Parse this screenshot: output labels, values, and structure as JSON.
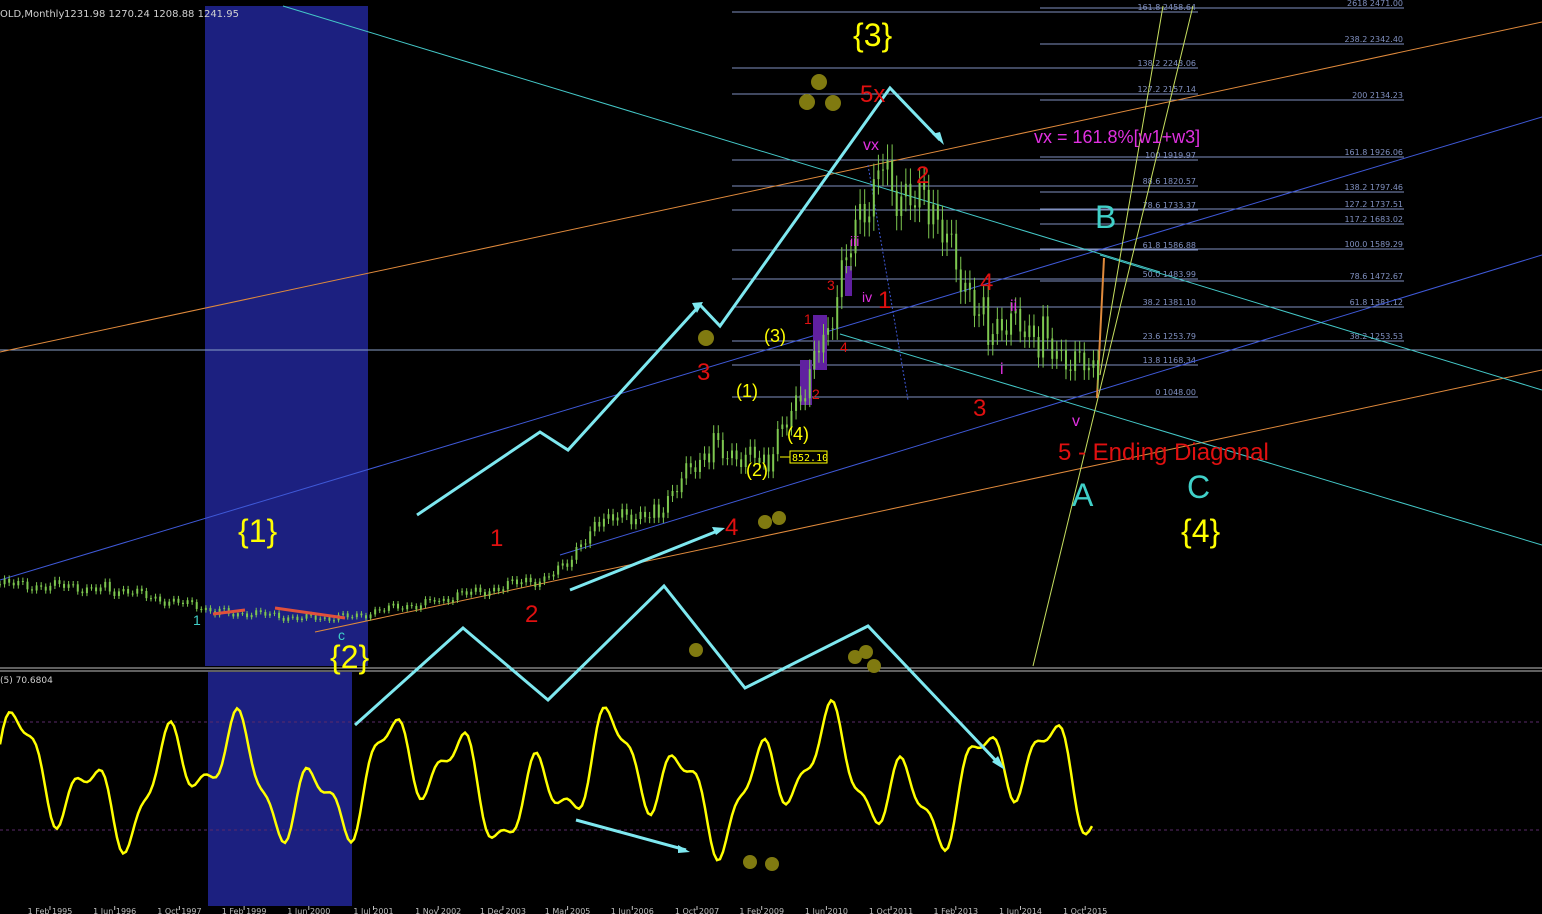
{
  "window": {
    "symbol_info": "OLD,Monthly",
    "ohlc": "1231.98 1270.24 1208.88 1241.95",
    "indicator_label": "(5) 70.6804",
    "price_box": "852.10"
  },
  "x_axis": {
    "ticks": [
      "1 Feb 1995",
      "1 Jun 1996",
      "1 Oct 1997",
      "1 Feb 1999",
      "1 Jun 2000",
      "1 Jul 2001",
      "1 Nov 2002",
      "1 Dec 2003",
      "1 Mar 2005",
      "1 Jun 2006",
      "1 Oct 2007",
      "1 Feb 2009",
      "1 Jun 2010",
      "1 Oct 2011",
      "1 Feb 2013",
      "1 Jun 2014",
      "1 Oct 2015"
    ]
  },
  "fib_levels_left": [
    {
      "label": "161.8 2458.64"
    },
    {
      "label": "138.2 2243.06"
    },
    {
      "label": "127.2 2157.14"
    },
    {
      "label": "100 1919.97"
    },
    {
      "label": "88.6 1820.57"
    },
    {
      "label": "78.6 1733.37"
    },
    {
      "label": "61.8 1586.88"
    },
    {
      "label": "50.0 1483.99"
    },
    {
      "label": "38.2 1381.10"
    },
    {
      "label": "23.6 1253.79"
    },
    {
      "label": "13.8 1168.34"
    },
    {
      "label": "0 1048.00"
    }
  ],
  "fib_levels_right": [
    {
      "label": "2618 2471.00"
    },
    {
      "label": "238.2 2342.40"
    },
    {
      "label": "200 2134.23"
    },
    {
      "label": "161.8 1926.06"
    },
    {
      "label": "138.2 1797.46"
    },
    {
      "label": "127.2 1737.51"
    },
    {
      "label": "117.2 1683.02"
    },
    {
      "label": "100.0 1589.29"
    },
    {
      "label": "78.6 1472.67"
    },
    {
      "label": "61.8 1381.12"
    },
    {
      "label": "38.2 1253.53"
    }
  ],
  "wave_labels": [
    {
      "text": "{1}",
      "color": "#ffff00"
    },
    {
      "text": "{2}",
      "color": "#ffff00"
    },
    {
      "text": "{3}",
      "color": "#ffff00"
    },
    {
      "text": "{4}",
      "color": "#ffff00"
    },
    {
      "text": "1",
      "color": "#e01010"
    },
    {
      "text": "2",
      "color": "#e01010"
    },
    {
      "text": "3",
      "color": "#e01010"
    },
    {
      "text": "4",
      "color": "#e01010"
    },
    {
      "text": "5x",
      "color": "#e01010"
    },
    {
      "text": "(1)",
      "color": "#ffff00"
    },
    {
      "text": "(2)",
      "color": "#ffff00"
    },
    {
      "text": "(3)",
      "color": "#ffff00"
    },
    {
      "text": "(4)",
      "color": "#ffff00"
    },
    {
      "text": "vx",
      "color": "#e030e0"
    },
    {
      "text": "iii",
      "color": "#e030e0"
    },
    {
      "text": "iv",
      "color": "#e030e0"
    },
    {
      "text": "ii",
      "color": "#e030e0"
    },
    {
      "text": "i",
      "color": "#e030e0"
    },
    {
      "text": "v",
      "color": "#e030e0"
    },
    {
      "text": "1",
      "color": "#e01010"
    },
    {
      "text": "2",
      "color": "#e01010"
    },
    {
      "text": "3",
      "color": "#e01010"
    },
    {
      "text": "4",
      "color": "#e01010"
    },
    {
      "text": "1",
      "color": "#e01010"
    },
    {
      "text": "2",
      "color": "#e01010"
    },
    {
      "text": "3",
      "color": "#e01010"
    },
    {
      "text": "4",
      "color": "#e01010"
    },
    {
      "text": "A",
      "color": "#40d0c8"
    },
    {
      "text": "B",
      "color": "#40d0c8"
    },
    {
      "text": "C",
      "color": "#40d0c8"
    },
    {
      "text": "5 - Ending Diagonal",
      "color": "#e01010"
    },
    {
      "text": "vx = 161.8%[w1+w3]",
      "color": "#e030e0"
    },
    {
      "text": "c",
      "color": "#40d0c8"
    },
    {
      "text": "1",
      "color": "#40d0c8"
    }
  ],
  "colors": {
    "background": "#000000",
    "candles": "#7ec850",
    "oscillator": "#ffff00",
    "arrows": "#7ee8f0",
    "shaded_zone": "#1c2080",
    "fib_lines": "#8090c0",
    "channel_blue": "#3f59d8",
    "channel_orange": "#e08a3c",
    "channel_cyan": "#44c8c8",
    "fan_yellow": "#c8e060",
    "dots": "#807a10"
  },
  "chart_data": {
    "type": "candlestick",
    "title": "",
    "xlabel": "",
    "ylabel": "",
    "timeframe": "Monthly",
    "last_bar": {
      "open": 1231.98,
      "high": 1270.24,
      "low": 1208.88,
      "close": 1241.95
    },
    "x": [
      "1995",
      "1997",
      "1999",
      "2001",
      "2003",
      "2005",
      "2006",
      "2007",
      "2008",
      "2009",
      "2010",
      "2011",
      "2012",
      "2013",
      "2014",
      "2015"
    ],
    "series": [
      {
        "values": [
          385,
          370,
          290,
          260,
          330,
          410,
          600,
          650,
          870,
          800,
          1250,
          1850,
          1650,
          1300,
          1250,
          1100
        ]
      }
    ],
    "grid": false
  }
}
